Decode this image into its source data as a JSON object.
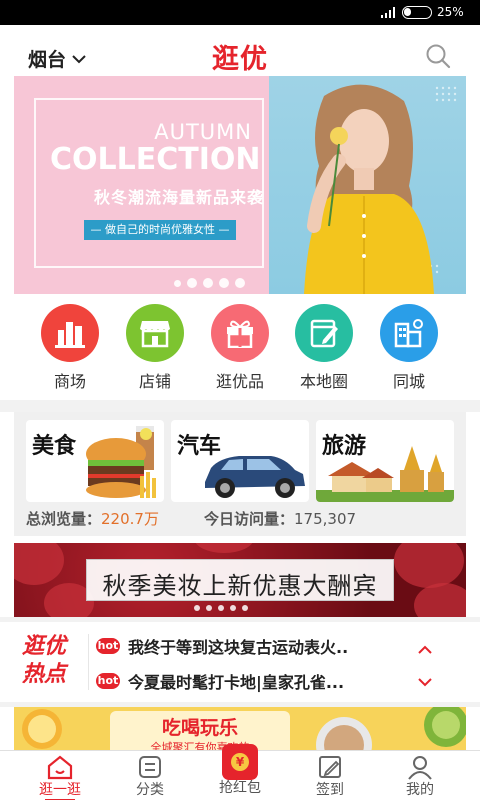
{
  "statusbar": {
    "battery_text": "25%",
    "battery_percent": 25
  },
  "header": {
    "city": "烟台",
    "brand": "逛优"
  },
  "banner": {
    "autumn": "AUTUMN",
    "collection": "COLLECTION",
    "subtitle": "秋冬潮流海量新品来袭",
    "tagline": "— 做自己的时尚优雅女性 —",
    "slides_total": 5,
    "active_slide": 1
  },
  "nav": [
    {
      "label": "商场",
      "color": "#f0443c",
      "icon": "building-icon"
    },
    {
      "label": "店铺",
      "color": "#7dc430",
      "icon": "shop-icon"
    },
    {
      "label": "逛优品",
      "color": "#f76a74",
      "icon": "gift-icon"
    },
    {
      "label": "本地圈",
      "color": "#27bea1",
      "icon": "notebook-icon"
    },
    {
      "label": "同城",
      "color": "#2a9ee8",
      "icon": "city-icon"
    }
  ],
  "categories": [
    {
      "title": "美食",
      "icon": "burger-icon"
    },
    {
      "title": "汽车",
      "icon": "car-icon"
    },
    {
      "title": "旅游",
      "icon": "temple-icon"
    }
  ],
  "stats": {
    "total_label": "总浏览量：",
    "total_value": "220.7万",
    "today_label": "今日访问量：",
    "today_value": "175,307"
  },
  "promo": {
    "text": "秋季美妆上新优惠大酬宾"
  },
  "hot": {
    "logo_line1": "逛优",
    "logo_line2": "热点",
    "badge": "hot",
    "items": [
      "我终于等到这块复古运动表火..",
      "今夏最时髦打卡地|皇家孔雀..."
    ]
  },
  "yellowad": {
    "big": "吃喝玩乐",
    "small": "全城聚汇有你喜欢的"
  },
  "tabs": [
    {
      "label": "逛一逛",
      "active": true
    },
    {
      "label": "分类",
      "active": false
    },
    {
      "label": "抢红包",
      "active": false
    },
    {
      "label": "签到",
      "active": false
    },
    {
      "label": "我的",
      "active": false
    }
  ],
  "colors": {
    "brand_red": "#e5242c",
    "stat_orange": "#e2702a"
  }
}
